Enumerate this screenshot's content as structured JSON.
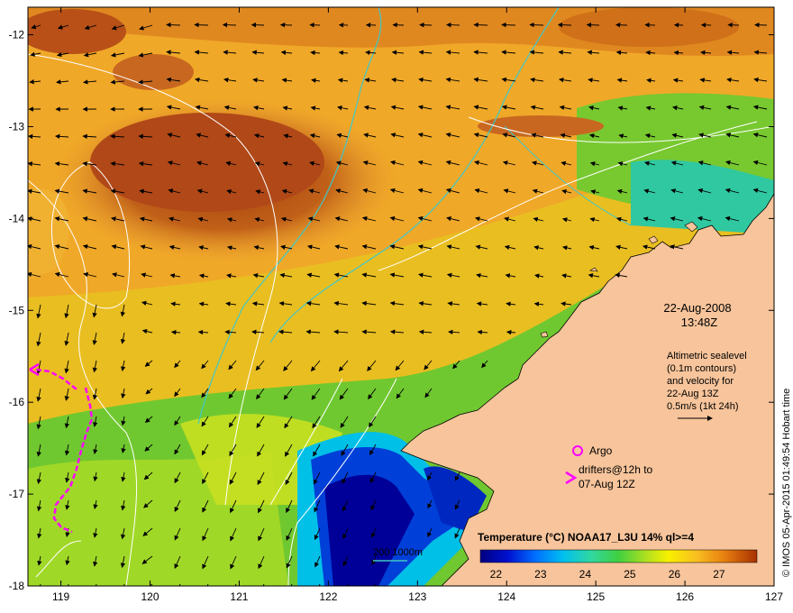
{
  "map": {
    "lon_ticks": [
      "119",
      "120",
      "121",
      "122",
      "123",
      "124",
      "125",
      "126",
      "127"
    ],
    "lat_ticks": [
      "-12",
      "-13",
      "-14",
      "-15",
      "-16",
      "-17",
      "-18"
    ],
    "date": "22-Aug-2008",
    "time": "13:48Z",
    "altimetry_lines": [
      "Altimetric sealevel",
      "(0.1m contours)",
      "and velocity for",
      "22-Aug 13Z",
      "0.5m/s (1kt 24h)"
    ],
    "argo_label": "Argo",
    "drifters_lines": [
      "drifters@12h to",
      "07-Aug 12Z"
    ],
    "isobath_label": "200  1000m",
    "colorbar_title": "Temperature (°C) NOAA17_L3U 14% ql>=4",
    "colorbar_ticks": [
      "22",
      "23",
      "24",
      "25",
      "26",
      "27"
    ],
    "credit": "© IMOS 05-Apr-2015 01:49:54 Hobart time",
    "colors": {
      "land": "#f7c49b",
      "isobath": "#40c8c8",
      "drifter": "#ff00ff",
      "contour": "#ffffff"
    }
  }
}
